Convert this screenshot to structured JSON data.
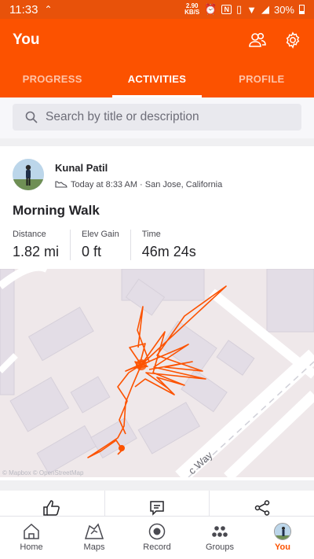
{
  "status_bar": {
    "time": "11:33",
    "speed": "2.90",
    "speed_unit": "KB/S",
    "battery": "30%"
  },
  "header": {
    "title": "You"
  },
  "tabs": [
    {
      "label": "PROGRESS",
      "active": false
    },
    {
      "label": "ACTIVITIES",
      "active": true
    },
    {
      "label": "PROFILE",
      "active": false
    }
  ],
  "search": {
    "placeholder": "Search by title or description"
  },
  "activity": {
    "athlete_name": "Kunal Patil",
    "meta": "Today at 8:33 AM · San Jose, California",
    "title": "Morning Walk",
    "stats": [
      {
        "label": "Distance",
        "value": "1.82 mi"
      },
      {
        "label": "Elev Gain",
        "value": "0 ft"
      },
      {
        "label": "Time",
        "value": "46m 24s"
      }
    ],
    "map_street_label": "c Way",
    "route_color": "#fc5200"
  },
  "bottom_nav": [
    {
      "label": "Home",
      "icon": "home-icon",
      "active": false
    },
    {
      "label": "Maps",
      "icon": "map-icon",
      "active": false
    },
    {
      "label": "Record",
      "icon": "record-icon",
      "active": false
    },
    {
      "label": "Groups",
      "icon": "groups-icon",
      "active": false
    },
    {
      "label": "You",
      "icon": "avatar",
      "active": true
    }
  ],
  "colors": {
    "brand": "#fc5200",
    "text": "#242428",
    "muted": "#494950"
  }
}
